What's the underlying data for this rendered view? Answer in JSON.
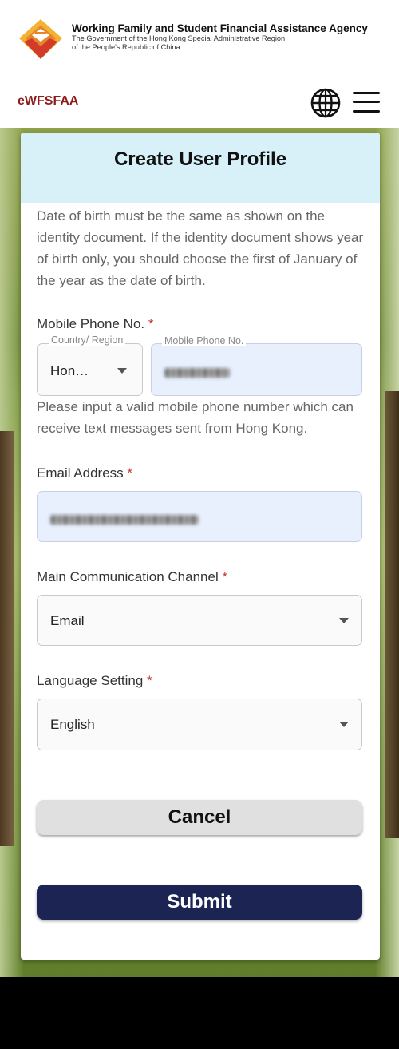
{
  "header": {
    "agency_name": "Working Family and Student Financial Assistance Agency",
    "agency_sub_line1": "The Government of the Hong Kong Special Administrative Region",
    "agency_sub_line2": "of the People's Republic of China",
    "brand": "eWFSFAA",
    "icons": {
      "logo": "agency-logo",
      "language": "globe-icon",
      "menu": "hamburger-menu-icon"
    },
    "brand_color": "#8b1d1d"
  },
  "form": {
    "title": "Create User Profile",
    "dob_note": "Date of birth must be the same as shown on the identity document. If the identity document shows year of birth only, you should choose the first of January of the year as the date of birth.",
    "mobile": {
      "label": "Mobile Phone No.",
      "required_mark": "*",
      "country_label": "Country/ Region",
      "country_value": "Hon…",
      "number_label": "Mobile Phone No.",
      "hint": "Please input a valid mobile phone number which can receive text messages sent from Hong Kong."
    },
    "email": {
      "label": "Email Address",
      "required_mark": "*"
    },
    "channel": {
      "label": "Main Communication Channel",
      "required_mark": "*",
      "value": "Email"
    },
    "language": {
      "label": "Language Setting",
      "required_mark": "*",
      "value": "English"
    },
    "cancel_label": "Cancel",
    "submit_label": "Submit"
  },
  "colors": {
    "header_band": "#d8f1f8",
    "submit_bg": "#1b2452",
    "cancel_bg": "#e0e0e0",
    "required": "#c0392b",
    "autofill_bg": "#e8f0fe"
  }
}
